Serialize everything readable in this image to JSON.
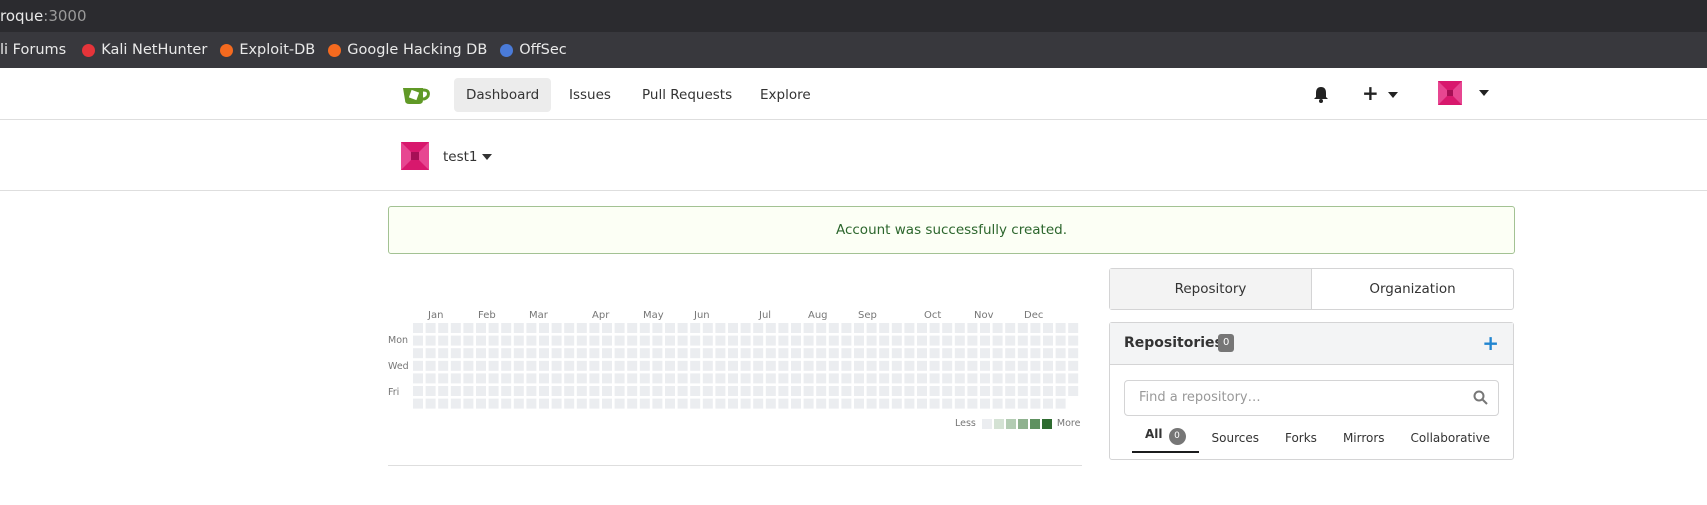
{
  "browser": {
    "url_host": "roque",
    "url_port": ":3000",
    "bookmarks": [
      {
        "label": "li Forums",
        "color": ""
      },
      {
        "label": "Kali NetHunter",
        "color": "#e5343a"
      },
      {
        "label": "Exploit-DB",
        "color": "#f46a1f"
      },
      {
        "label": "Google Hacking DB",
        "color": "#f46a1f"
      },
      {
        "label": "OffSec",
        "color": "#4a7bd9"
      }
    ]
  },
  "nav": {
    "items": [
      "Dashboard",
      "Issues",
      "Pull Requests",
      "Explore"
    ],
    "active": "Dashboard",
    "icons": [
      "bell-icon",
      "plus-icon",
      "avatar"
    ]
  },
  "context": {
    "user": "test1"
  },
  "flash": {
    "message": "Account was successfully created."
  },
  "heatmap": {
    "months": [
      "Jan",
      "Feb",
      "Mar",
      "Apr",
      "May",
      "Jun",
      "Jul",
      "Aug",
      "Sep",
      "Oct",
      "Nov",
      "Dec"
    ],
    "days": [
      "Mon",
      "Wed",
      "Fri"
    ],
    "legend_less": "Less",
    "legend_more": "More",
    "colors": [
      "#ebedf0",
      "#d4e2d4",
      "#b3ccb3",
      "#8fb28f",
      "#5e9160",
      "#2e6b30"
    ]
  },
  "dashboard": {
    "tabs": [
      "Repository",
      "Organization"
    ],
    "active_tab": "Repository",
    "repositories_title": "Repositories",
    "repositories_count": "0",
    "search_placeholder": "Find a repository…",
    "filters": [
      {
        "label": "All",
        "count": "0"
      },
      {
        "label": "Sources"
      },
      {
        "label": "Forks"
      },
      {
        "label": "Mirrors"
      },
      {
        "label": "Collaborative"
      }
    ],
    "accent": "#2185d0"
  }
}
